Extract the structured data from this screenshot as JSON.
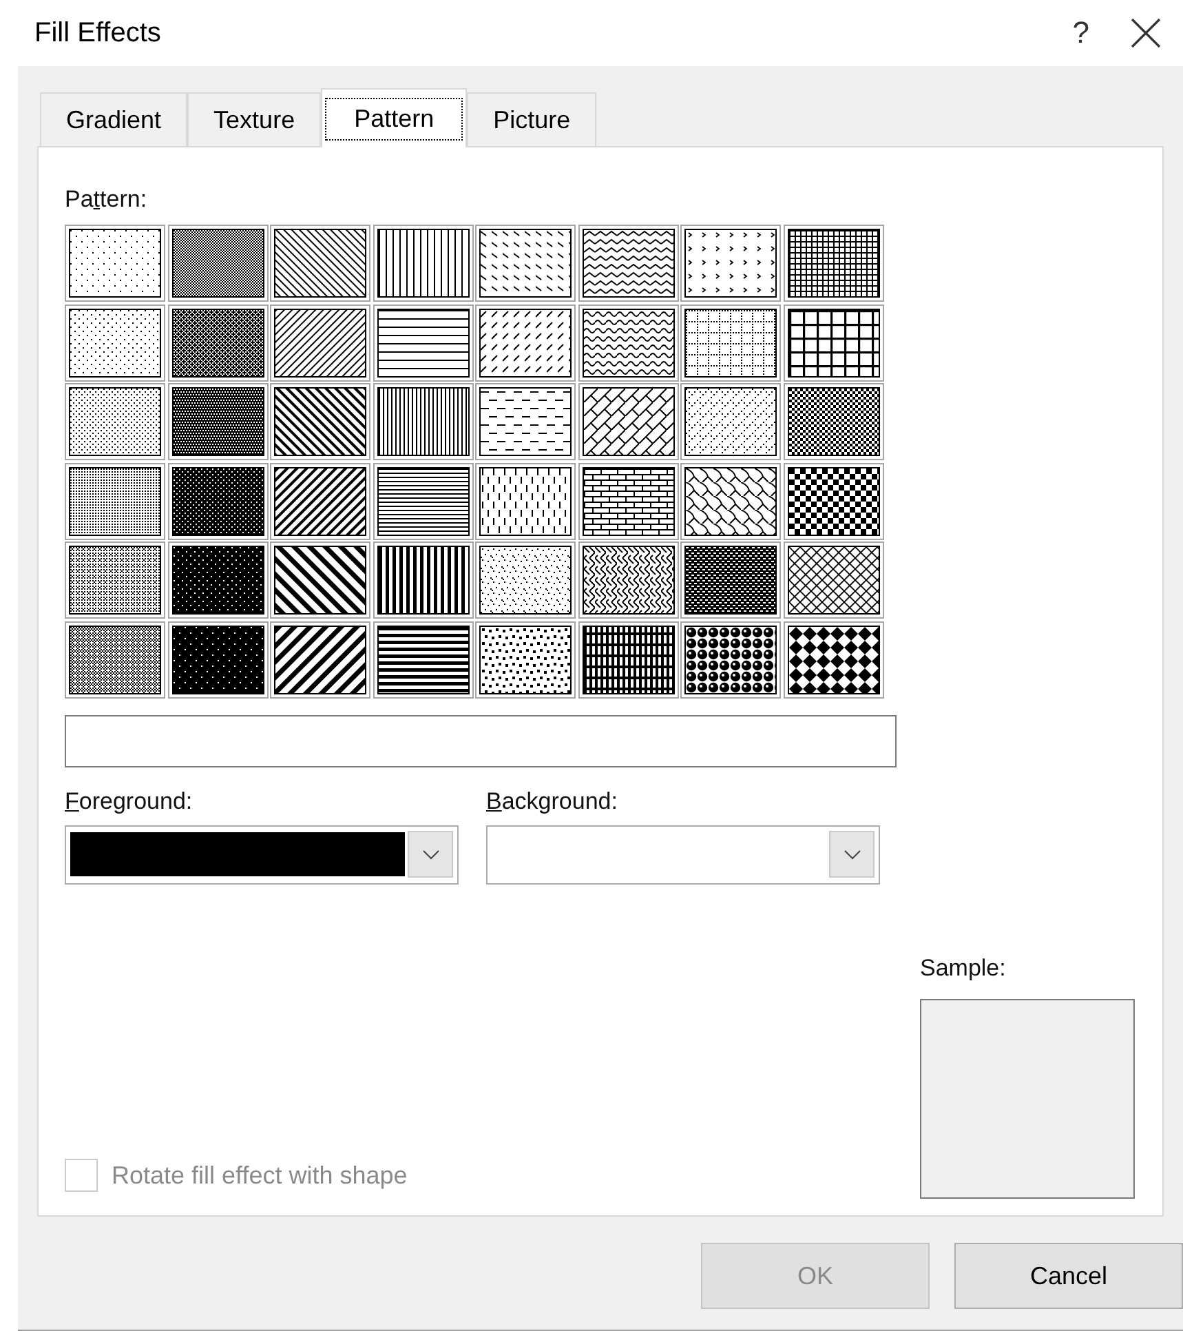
{
  "window": {
    "title": "Fill Effects",
    "help_button": "?"
  },
  "tabs": [
    {
      "label": "Gradient",
      "selected": false
    },
    {
      "label": "Texture",
      "selected": false
    },
    {
      "label": "Pattern",
      "selected": true
    },
    {
      "label": "Picture",
      "selected": false
    }
  ],
  "pattern_label": {
    "before": "Pa",
    "key": "t",
    "after": "tern:"
  },
  "patterns": [
    {
      "kind": "pct5",
      "selected": false
    },
    {
      "kind": "pct50",
      "selected": false
    },
    {
      "kind": "lightdowndiag",
      "selected": false
    },
    {
      "kind": "lightvert",
      "selected": false
    },
    {
      "kind": "dasheddowndiag",
      "selected": false
    },
    {
      "kind": "zigzag",
      "selected": false
    },
    {
      "kind": "divot",
      "selected": false
    },
    {
      "kind": "smallgrid",
      "selected": false
    },
    {
      "kind": "pct10",
      "selected": false
    },
    {
      "kind": "pct60",
      "selected": false
    },
    {
      "kind": "lightupdiag",
      "selected": false
    },
    {
      "kind": "lighthoriz",
      "selected": false
    },
    {
      "kind": "dashedupdiag",
      "selected": false
    },
    {
      "kind": "wave",
      "selected": false
    },
    {
      "kind": "dottedgrid",
      "selected": false
    },
    {
      "kind": "largegrid",
      "selected": false
    },
    {
      "kind": "pct20",
      "selected": false
    },
    {
      "kind": "pct70",
      "selected": false
    },
    {
      "kind": "darkdowndiag",
      "selected": false
    },
    {
      "kind": "narrowvert",
      "selected": false
    },
    {
      "kind": "dashedhoriz",
      "selected": false
    },
    {
      "kind": "diagbrick",
      "selected": false
    },
    {
      "kind": "dotteddiamond",
      "selected": false
    },
    {
      "kind": "smallchecker",
      "selected": false
    },
    {
      "kind": "pct25",
      "selected": false
    },
    {
      "kind": "pct75",
      "selected": false
    },
    {
      "kind": "darkupdiag",
      "selected": false
    },
    {
      "kind": "narrowhoriz",
      "selected": false
    },
    {
      "kind": "dashedvert",
      "selected": false
    },
    {
      "kind": "horizbrick",
      "selected": false
    },
    {
      "kind": "shingle",
      "selected": false
    },
    {
      "kind": "largechecker",
      "selected": false
    },
    {
      "kind": "pct30",
      "selected": false
    },
    {
      "kind": "pct80",
      "selected": false
    },
    {
      "kind": "widedowndiag",
      "selected": false
    },
    {
      "kind": "darkvert",
      "selected": false
    },
    {
      "kind": "smallconfetti",
      "selected": false
    },
    {
      "kind": "weave",
      "selected": false
    },
    {
      "kind": "trellis",
      "selected": false
    },
    {
      "kind": "outlineddiamond",
      "selected": false
    },
    {
      "kind": "pct40",
      "selected": false
    },
    {
      "kind": "pct90",
      "selected": false
    },
    {
      "kind": "wideupdiag",
      "selected": false
    },
    {
      "kind": "darkhoriz",
      "selected": false
    },
    {
      "kind": "largeconfetti",
      "selected": false
    },
    {
      "kind": "plaid",
      "selected": false
    },
    {
      "kind": "sphere",
      "selected": false
    },
    {
      "kind": "soliddiamond",
      "selected": false
    }
  ],
  "foreground": {
    "label": {
      "key": "F",
      "after": "oreground:"
    },
    "color": "#000000"
  },
  "background": {
    "label": {
      "key": "B",
      "after": "ackground:"
    }
  },
  "sample_label": "Sample:",
  "rotate_checkbox": {
    "label": "Rotate fill effect with shape",
    "checked": false,
    "disabled": true
  },
  "buttons": [
    {
      "label": "OK",
      "disabled": true
    },
    {
      "label": "Cancel",
      "disabled": false
    }
  ]
}
